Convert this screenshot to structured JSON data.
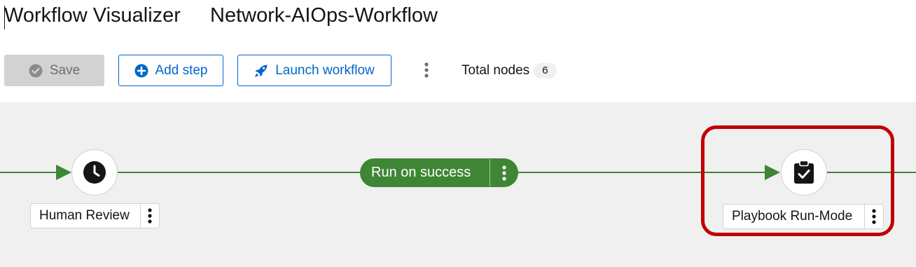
{
  "header": {
    "title": "Workflow Visualizer",
    "workflow_name": "Network-AIOps-Workflow"
  },
  "toolbar": {
    "save_label": "Save",
    "add_step_label": "Add step",
    "launch_label": "Launch workflow",
    "total_nodes_label": "Total nodes",
    "total_nodes_count": "6"
  },
  "canvas": {
    "nodes": [
      {
        "label": "Human Review",
        "icon": "clock-icon"
      },
      {
        "label": "Playbook Run-Mode",
        "icon": "clipboard-check-icon",
        "highlighted": true
      }
    ],
    "edge_label": "Run on success"
  },
  "colors": {
    "accent": "#0066cc",
    "success": "#3e8635",
    "highlight": "#c00000",
    "canvas_bg": "#f0f0f0",
    "disabled_bg": "#d2d2d2"
  }
}
